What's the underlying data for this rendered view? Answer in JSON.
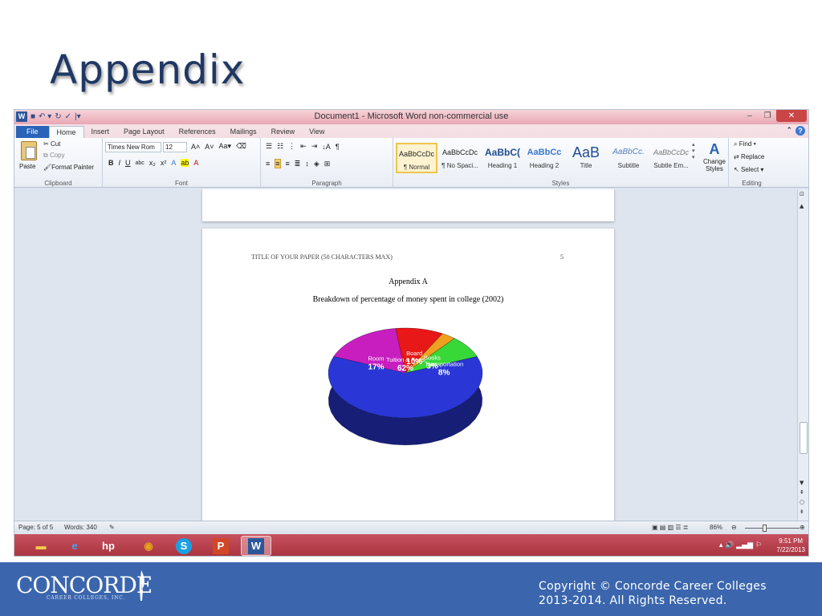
{
  "slide": {
    "title": "Appendix",
    "footer_line1": "Copyright © Concorde Career Colleges",
    "footer_line2": "2013-2014. All Rights Reserved.",
    "logo_text": "CONCORDE",
    "logo_sub": "CAREER COLLEGES, INC."
  },
  "window": {
    "title": "Document1 - Microsoft Word non-commercial use",
    "tabs": [
      "File",
      "Home",
      "Insert",
      "Page Layout",
      "References",
      "Mailings",
      "Review",
      "View"
    ]
  },
  "ribbon": {
    "clipboard": {
      "paste": "Paste",
      "cut": "Cut",
      "copy": "Copy",
      "format_painter": "Format Painter",
      "label": "Clipboard"
    },
    "font": {
      "name": "Times New Rom",
      "size": "12",
      "label": "Font"
    },
    "paragraph": {
      "label": "Paragraph"
    },
    "styles": {
      "label": "Styles",
      "items": [
        {
          "sample": "AaBbCcDc",
          "name": "¶ Normal"
        },
        {
          "sample": "AaBbCcDc",
          "name": "¶ No Spaci..."
        },
        {
          "sample": "AaBbC(",
          "name": "Heading 1"
        },
        {
          "sample": "AaBbCc",
          "name": "Heading 2"
        },
        {
          "sample": "AaB",
          "name": "Title"
        },
        {
          "sample": "AaBbCc.",
          "name": "Subtitle"
        },
        {
          "sample": "AaBbCcDc",
          "name": "Subtle Em..."
        }
      ],
      "change_styles_1": "Change",
      "change_styles_2": "Styles"
    },
    "editing": {
      "find": "Find",
      "replace": "Replace",
      "select": "Select",
      "label": "Editing"
    }
  },
  "document": {
    "running_head": "TITLE OF YOUR PAPER (50 CHARACTERS MAX)",
    "page_number": "5",
    "heading": "Appendix A",
    "caption": "Breakdown of percentage of money spent in college (2002)"
  },
  "chart_data": {
    "type": "pie",
    "title": "",
    "slices": [
      {
        "label": "Tuition & Fees",
        "value": 62,
        "display": "62%",
        "color": "#2a37d6"
      },
      {
        "label": "Room",
        "value": 17,
        "display": "17%",
        "color": "#c81ec0"
      },
      {
        "label": "Board",
        "value": 10,
        "display": "10%",
        "color": "#e81818"
      },
      {
        "label": "Books",
        "value": 3,
        "display": "3%",
        "color": "#f0a020"
      },
      {
        "label": "Transportation",
        "value": 8,
        "display": "8%",
        "color": "#38d838"
      }
    ]
  },
  "status": {
    "page": "Page: 5 of 5",
    "words": "Words: 340",
    "zoom": "86%"
  },
  "taskbar": {
    "time": "9:51 PM",
    "date": "7/22/2013"
  }
}
